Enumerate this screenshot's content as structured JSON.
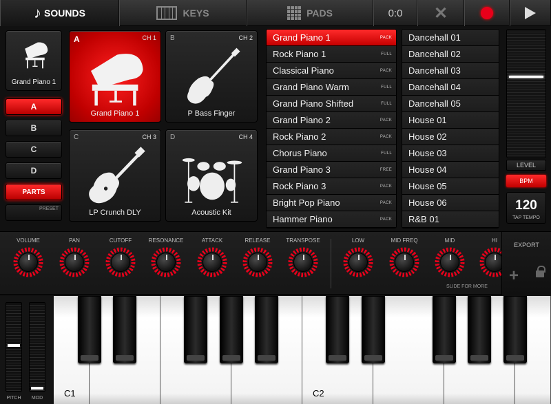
{
  "topbar": {
    "sounds": "SOUNDS",
    "keys": "KEYS",
    "pads": "PADS",
    "time": "0:0"
  },
  "preset_card": {
    "label": "Grand Piano 1"
  },
  "side_buttons": {
    "a": "A",
    "b": "B",
    "c": "C",
    "d": "D",
    "parts": "PARTS",
    "preset": "PRESET"
  },
  "slots": [
    {
      "letter": "A",
      "channel": "CH 1",
      "name": "Grand Piano 1",
      "icon": "grand-piano-icon"
    },
    {
      "letter": "B",
      "channel": "CH 2",
      "name": "P Bass Finger",
      "icon": "bass-guitar-icon"
    },
    {
      "letter": "C",
      "channel": "CH 3",
      "name": "LP Crunch DLY",
      "icon": "electric-guitar-icon"
    },
    {
      "letter": "D",
      "channel": "CH 4",
      "name": "Acoustic Kit",
      "icon": "drum-kit-icon"
    }
  ],
  "presets": [
    {
      "name": "Grand Piano 1",
      "tag": "PACK",
      "selected": true
    },
    {
      "name": "Rock Piano 1",
      "tag": "FULL"
    },
    {
      "name": "Classical Piano",
      "tag": "PACK"
    },
    {
      "name": "Grand Piano Warm",
      "tag": "FULL"
    },
    {
      "name": "Grand Piano Shifted",
      "tag": "FULL"
    },
    {
      "name": "Grand Piano 2",
      "tag": "PACK"
    },
    {
      "name": "Rock Piano 2",
      "tag": "PACK"
    },
    {
      "name": "Chorus Piano",
      "tag": "FULL"
    },
    {
      "name": "Grand Piano 3",
      "tag": "FREE"
    },
    {
      "name": "Rock Piano 3",
      "tag": "PACK"
    },
    {
      "name": "Bright Pop Piano",
      "tag": "PACK"
    },
    {
      "name": "Hammer Piano",
      "tag": "PACK"
    }
  ],
  "styles": [
    "Dancehall 01",
    "Dancehall 02",
    "Dancehall 03",
    "Dancehall 04",
    "Dancehall 05",
    "House 01",
    "House 02",
    "House 03",
    "House 04",
    "House 05",
    "House 06",
    "R&B 01"
  ],
  "level": {
    "label": "LEVEL",
    "value": 0.63
  },
  "bpm": {
    "label": "BPM"
  },
  "tempo": {
    "value": "120",
    "label": "TAP TEMPO"
  },
  "knobs": [
    {
      "label": "VOLUME"
    },
    {
      "label": "PAN"
    },
    {
      "label": "CUTOFF"
    },
    {
      "label": "RESONANCE"
    },
    {
      "label": "ATTACK"
    },
    {
      "label": "RELEASE"
    },
    {
      "label": "TRANSPOSE"
    },
    {
      "label": "LOW"
    },
    {
      "label": "MID FREQ"
    },
    {
      "label": "MID"
    },
    {
      "label": "HI"
    }
  ],
  "slide_more": "SLIDE FOR MORE",
  "export": "EXPORT",
  "wheels": {
    "pitch": "PITCH",
    "mod": "MOD"
  },
  "keyboard": {
    "c1": "C1",
    "c2": "C2"
  },
  "colors": {
    "accent": "#e8001a",
    "panel": "#1b1b1b"
  }
}
